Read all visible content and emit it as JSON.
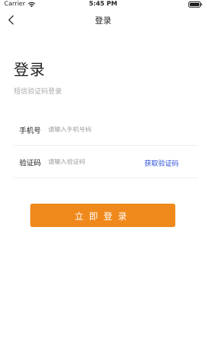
{
  "status_bar": {
    "carrier": "Carrier",
    "time": "5:45 PM"
  },
  "nav": {
    "title": "登录",
    "back_icon": "chevron-left-icon"
  },
  "page": {
    "heading": "登录",
    "subtitle": "短信验证码登录"
  },
  "form": {
    "phone": {
      "label": "手机号",
      "placeholder": "请输入手机号码",
      "value": ""
    },
    "code": {
      "label": "验证码",
      "placeholder": "请输入验证码",
      "value": "",
      "get_code_label": "获取验证码"
    }
  },
  "login_button": {
    "label": "立即登录"
  },
  "colors": {
    "accent": "#f0891c",
    "link": "#2b4fd6"
  }
}
